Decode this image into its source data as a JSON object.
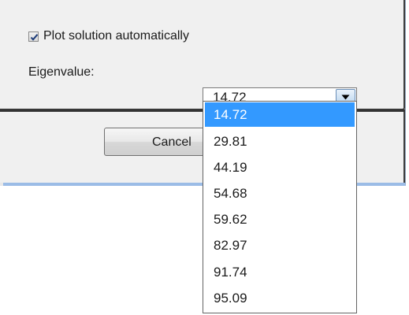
{
  "options": {
    "plot_checkbox": {
      "label": "Plot solution automatically",
      "checked": true
    },
    "eigenvalue": {
      "label": "Eigenvalue:",
      "selected": "14.72",
      "items": [
        "14.72",
        "29.81",
        "44.19",
        "54.68",
        "59.62",
        "82.97",
        "91.74",
        "95.09"
      ]
    }
  },
  "buttons": {
    "cancel_label": "Cancel"
  },
  "icons": {
    "checkbox": "checkmark-icon",
    "combo_arrow": "chevron-down-icon"
  },
  "colors": {
    "selection": "#3399ff",
    "checkmark": "#1f3d7a",
    "window_accent": "#9bbce6"
  }
}
